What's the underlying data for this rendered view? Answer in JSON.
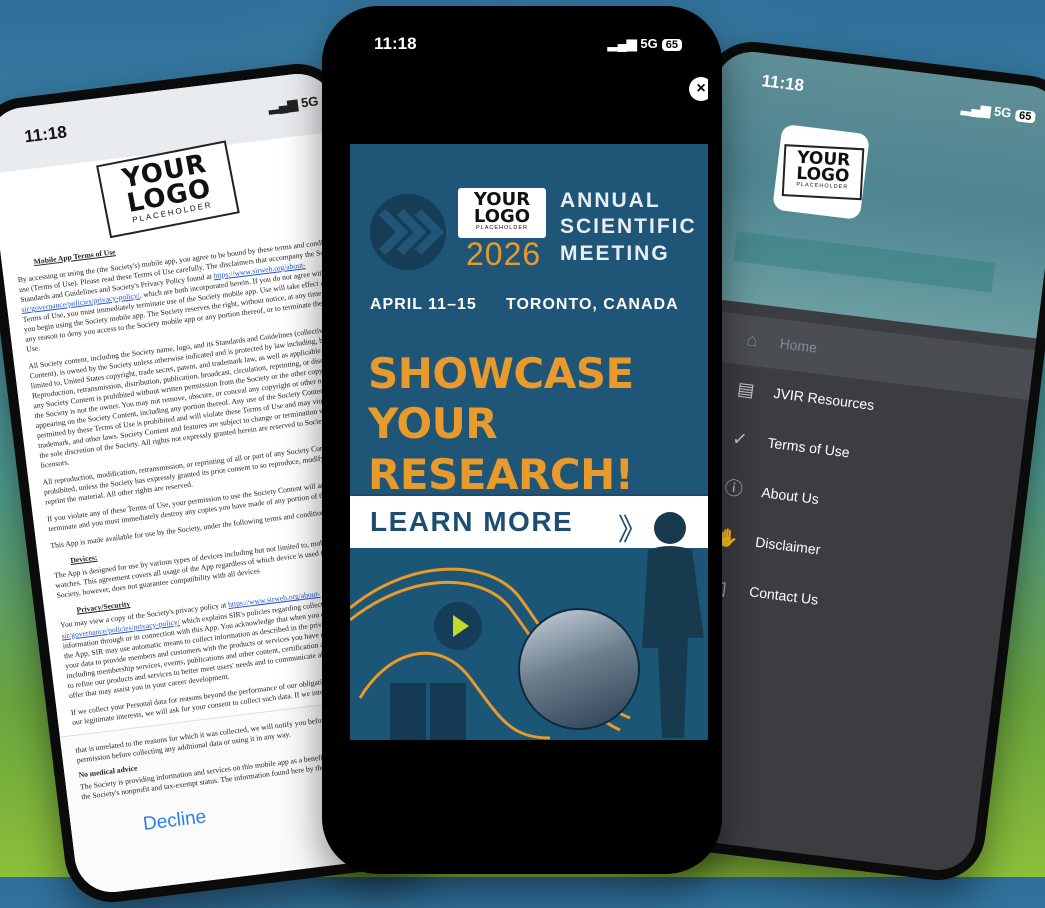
{
  "status_time": "11:18",
  "status_network": "5G",
  "status_battery": "65",
  "logo": {
    "line1": "YOUR",
    "line2": "LOGO",
    "sub": "PLACEHOLDER"
  },
  "left_screen": {
    "doc_title": "Mobile App Terms of Use",
    "paragraphs": [
      "By accessing or using the                                       (the Society's) mobile app, you agree to be bound by these terms and conditions of use (Terms of Use). Please read these Terms of Use carefully. The disclaimers that accompany the Society's Standards and Guidelines and Society's Privacy Policy found at",
      "https://www.sirweb.org/about-sir/governance/policies/privacy-policy/",
      "which are both incorporated herein. If you do not agree with these Terms of Use, you must immediately terminate use of the Society mobile app. Use will take effect at the time you begin using the Society mobile app. The Society reserves the right, without notice, at any time and for any reason to deny you access to the Society mobile app or any portion thereof, or to terminate these Terms of Use.",
      "All Society content, including the Society name, logo, and its Standards and Guidelines (collectively, Society Content), is owned by the Society unless otherwise indicated and is protected by law including, but not limited to, United States copyright, trade secret, patent, and trademark law, as well as applicable state laws. Reproduction, retransmission, distribution, publication, broadcast, circulation, reprinting, or dissemination of any Society Content is prohibited without written permission from the Society or the other copyright owner if the Society is not the owner. You may not remove, obscure, or conceal any copyright or other notices appearing on the Society Content, including any portion thereof. Any use of the Society Content not expressly permitted by these Terms of Use is prohibited and will violate these Terms of Use and may violate copyright, trademark, and other laws. Society Content and features are subject to change or termination without notice in the sole discretion of the Society. All rights not expressly granted herein are reserved to Society and its licensors.",
      "All reproduction, modification, retransmission, or reprinting of all or part of any Society Content is expressly prohibited, unless the Society has expressly granted its prior consent to so reproduce, modify, retransmit, or reprint the material. All other rights are reserved.",
      "If you violate any of these Terms of Use, your permission to use the Society Content will automatically terminate and you must immediately destroy any copies you have made of any portion of the Society Content.",
      "This App is made available for use by the Society, under the following terms and conditions:"
    ],
    "devices_heading": "Devices:",
    "devices_text": "The App is designed for use by various types of devices including but not limited to, mobile telephones and watches. This agreement covers all usage of the App regardless of which device is used to access it. The Society, however, does not guarantee compatibility with all devices",
    "privacy_heading": "Privacy/Security",
    "privacy_text1": "You may view a copy of the Society's privacy policy at",
    "privacy_link": "https://www.sirweb.org/about-sir/governance/policies/privacy-policy/",
    "privacy_text2": "which explains SIR's policies regarding collection and use of your information through or in connection with this App. You acknowledge that when you download, install, or use the App, SIR may use automatic means to collect information as described in the privacy policy, processes your data to provide members and customers with the products or services you have requested from them us, including membership services, events, publications and other content, certification and to use the information to refine our products and services to better meet users' needs and to communicate about other services we offer that may assist you in your career development.",
    "privacy_text3": "If we collect your Personal data for reasons beyond the performance of our obligations to you, we will rely on our legitimate interests, we will ask for your consent to collect such data. If we intend to",
    "bottom_text": "that is unrelated to the reasons for which it was collected, we will notify you before doing so and ask permission before collecting any additional data or using it in any way.",
    "medical_heading": "No medical advice",
    "medical_text": "The Society is providing information and services on this mobile app as a benefit and service in furtherance of the Society's nonprofit and tax-exempt status. The information found here by the Society",
    "decline_label": "Decline"
  },
  "center_screen": {
    "close_icon": "×",
    "ad": {
      "year": "2026",
      "event_lines": [
        "ANNUAL",
        "SCIENTIFIC",
        "MEETING"
      ],
      "dates": "APRIL 11–15",
      "location": "TORONTO, CANADA",
      "headline_lines": [
        "SHOWCASE YOUR",
        "RESEARCH!"
      ],
      "cta": "LEARN MORE",
      "cta_arrow": "》",
      "colors": {
        "navy": "#1f5678",
        "orange": "#e89a2c",
        "lime": "#c3d92c"
      }
    }
  },
  "right_screen": {
    "menu": [
      {
        "label": "Home",
        "icon": "⌂",
        "icon_name": "home-icon",
        "active": true
      },
      {
        "label": "JVIR Resources",
        "icon": "▤",
        "icon_name": "document-icon",
        "active": false
      },
      {
        "label": "Terms of Use",
        "icon": "✓",
        "icon_name": "checklist-icon",
        "active": false
      },
      {
        "label": "About Us",
        "icon": "ⓘ",
        "icon_name": "info-icon",
        "active": false
      },
      {
        "label": "Disclaimer",
        "icon": "✋",
        "icon_name": "hand-icon",
        "active": false
      },
      {
        "label": "Contact Us",
        "icon": "▯",
        "icon_name": "phone-icon",
        "active": false
      }
    ]
  }
}
